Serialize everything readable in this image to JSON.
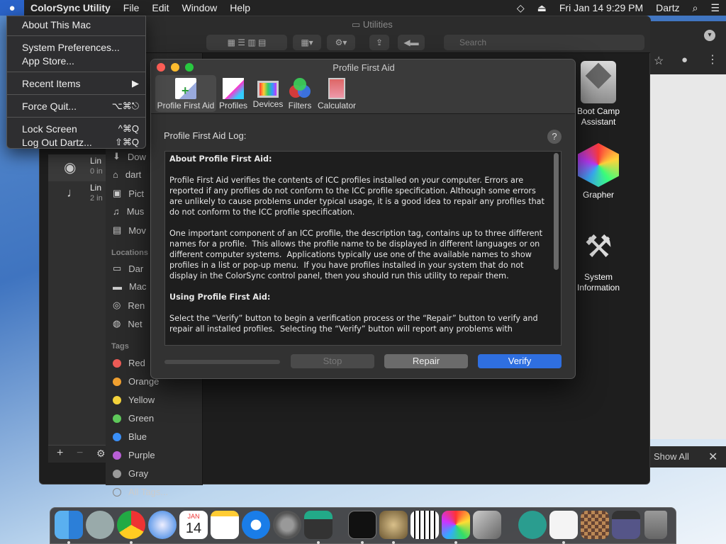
{
  "menubar": {
    "app_name": "ColorSync Utility",
    "menus": [
      "File",
      "Edit",
      "Window",
      "Help"
    ],
    "date_time": "Fri Jan 14  9:29 PM",
    "user": "Dartz"
  },
  "apple_menu": {
    "items": [
      {
        "label": "About This Mac",
        "shortcut": ""
      },
      {
        "label": "System Preferences...",
        "shortcut": ""
      },
      {
        "label": "App Store...",
        "shortcut": ""
      },
      {
        "label": "Recent Items",
        "shortcut": "▶"
      },
      {
        "label": "Force Quit...",
        "shortcut": "⌥⌘⎋"
      },
      {
        "label": "Lock Screen",
        "shortcut": "^⌘Q"
      },
      {
        "label": "Log Out Dartz...",
        "shortcut": "⇧⌘Q"
      }
    ]
  },
  "finder": {
    "title": "Utilities",
    "search_placeholder": "Search",
    "favorites": [
      "Dow",
      "dart",
      "Pict",
      "Mus",
      "Mov"
    ],
    "locations_header": "Locations",
    "locations": [
      "Dar",
      "Mac",
      "Ren",
      "Net"
    ],
    "tags_header": "Tags",
    "tags": [
      {
        "label": "Red",
        "color": "#ec5b56"
      },
      {
        "label": "Orange",
        "color": "#f0a030"
      },
      {
        "label": "Yellow",
        "color": "#f3d23b"
      },
      {
        "label": "Green",
        "color": "#5ec85a"
      },
      {
        "label": "Blue",
        "color": "#3a8ff7"
      },
      {
        "label": "Purple",
        "color": "#b85fd5"
      },
      {
        "label": "Gray",
        "color": "#9a9a9a"
      }
    ],
    "all_tags": "All Tags...",
    "left_items": [
      {
        "title": "Lin",
        "sub": "0 in"
      },
      {
        "title": "Lin",
        "sub": "2 in"
      }
    ]
  },
  "desktop_icons": [
    "Boot Camp Assistant",
    "Grapher",
    "System Information"
  ],
  "show_all": "Show All",
  "dialog": {
    "title": "Profile First Aid",
    "tabs": [
      "Profile First Aid",
      "Profiles",
      "Devices",
      "Filters",
      "Calculator"
    ],
    "log_label": "Profile First Aid Log:",
    "help": "?",
    "log": {
      "h1": "About Profile First Aid:",
      "p1": "Profile First Aid verifies the contents of ICC profiles installed on your computer. Errors are reported if any profiles do not conform to the ICC profile specification. Although some errors are unlikely to cause problems under typical usage, it is a good idea to repair any profiles that do not conform to the ICC profile specification.",
      "p2": "One important component of an ICC profile, the description tag, contains up to three different names for a profile.  This allows the profile name to be displayed in different languages or on different computer systems.  Applications typically use one of the available names to show profiles in a list or pop-up menu.  If you have profiles installed in your system that do not display in the ColorSync control panel, then you should run this utility to repair them.",
      "h2": "Using Profile First Aid:",
      "p3": "Select the “Verify” button to begin a verification process or the “Repair” button to verify and repair all installed profiles.  Selecting the “Verify” button will report any problems with"
    },
    "buttons": {
      "stop": "Stop",
      "repair": "Repair",
      "verify": "Verify"
    }
  },
  "dock": {
    "calendar_month": "JAN",
    "calendar_day": "14"
  }
}
